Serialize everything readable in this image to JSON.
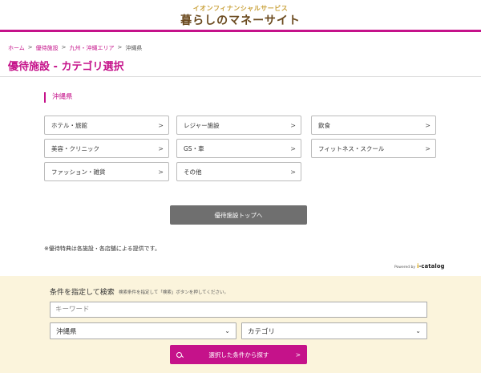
{
  "header": {
    "brand_sub": "イオンフィナンシャルサービス",
    "brand_main": "暮らしのマネーサイト"
  },
  "breadcrumb": {
    "items": [
      "ホーム",
      "優待施設",
      "九州・沖縄エリア",
      "沖縄県"
    ],
    "separator": ">"
  },
  "page_title": "優待施設 - カテゴリ選択",
  "prefecture_heading": "沖縄県",
  "categories": [
    "ホテル・旅館",
    "レジャー施設",
    "飲食",
    "美容・クリニック",
    "GS・車",
    "フィットネス・スクール",
    "ファッション・雑貨",
    "その他"
  ],
  "chevron": ">",
  "top_button_label": "優待施設トップへ",
  "note": "※優待特典は各施設・各店舗による提供です。",
  "powered_by": {
    "prefix": "Powered by",
    "brand_i": "i",
    "brand_rest": "-catalog"
  },
  "search": {
    "title": "条件を指定して検索",
    "help": "検索条件を指定して「検索」ボタンを押してください。",
    "keyword_placeholder": "キーワード",
    "prefecture_value": "沖縄県",
    "category_value": "カテゴリ",
    "submit_label": "選択した条件から探す",
    "submit_chevron": ">"
  },
  "colors": {
    "accent": "#c5128a",
    "panel_bg": "#fbf4dc",
    "top_button": "#6f6f6f"
  }
}
